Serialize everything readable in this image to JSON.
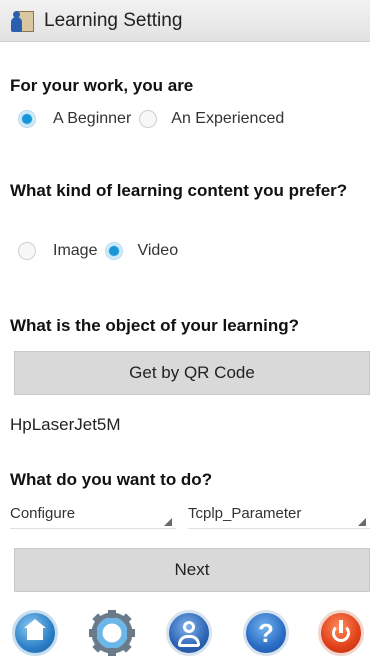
{
  "window": {
    "title": "Learning Setting",
    "app_icon": "learning-app-icon"
  },
  "work_level": {
    "question": "For your work, you are",
    "options": [
      {
        "label": "A Beginner",
        "selected": true
      },
      {
        "label": "An Experienced",
        "selected": false
      }
    ]
  },
  "content_type": {
    "question": "What kind of learning content you prefer?",
    "options": [
      {
        "label": "Image",
        "selected": false
      },
      {
        "label": "Video",
        "selected": true
      }
    ]
  },
  "learning_object": {
    "question": "What is the object of your learning?",
    "qr_button_label": "Get by QR Code",
    "value": "HpLaserJet5M"
  },
  "task": {
    "question": "What do you want to do?",
    "action_value": "Configure",
    "parameter_value": "Tcplp_Parameter"
  },
  "next_button_label": "Next",
  "toolbar": {
    "icons": [
      "home-icon",
      "settings-gear-icon",
      "user-profile-icon",
      "help-icon",
      "power-icon"
    ],
    "help_glyph": "?"
  },
  "colors": {
    "accent": "#1a96d8",
    "button_bg": "#d9d9d9"
  }
}
